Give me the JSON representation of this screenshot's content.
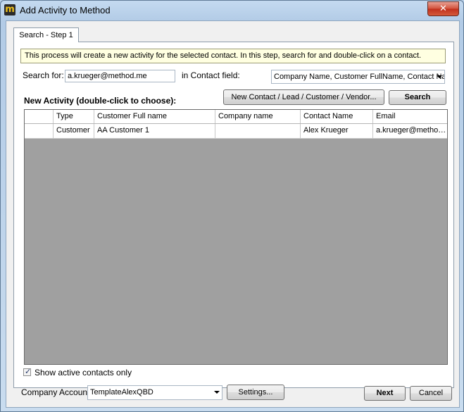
{
  "window": {
    "title": "Add Activity to Method",
    "app_icon_glyph": "m",
    "close_glyph": "✕"
  },
  "tabs": [
    {
      "label": "Search - Step 1"
    }
  ],
  "info_banner": "This process will create a new activity for the selected contact. In this step, search for and double-click on a contact.",
  "search": {
    "label": "Search for:",
    "value": "a.krueger@method.me",
    "field_label": "in Contact field:",
    "field_selected": "Company Name, Customer FullName, Contact Name, Email"
  },
  "grid_caption": "New Activity (double-click to choose):",
  "buttons": {
    "new_contact": "New Contact / Lead / Customer / Vendor...",
    "search": "Search",
    "settings": "Settings...",
    "next": "Next",
    "cancel": "Cancel"
  },
  "table": {
    "columns": [
      "Type",
      "Customer Full name",
      "Company name",
      "Contact Name",
      "Email"
    ],
    "rows": [
      [
        "Customer",
        "AA Customer 1",
        "",
        "Alex Krueger",
        "a.krueger@method.me"
      ]
    ]
  },
  "active_only": {
    "label": "Show active contacts only",
    "checked": true,
    "check_glyph": "✓"
  },
  "company_account": {
    "label": "Company Account",
    "selected": "TemplateAlexQBD"
  },
  "colors": {
    "title_bar": "#b9d1ea",
    "grid_empty": "#a0a0a0",
    "banner_bg": "#ffffe1",
    "close_button": "#c7402a"
  }
}
